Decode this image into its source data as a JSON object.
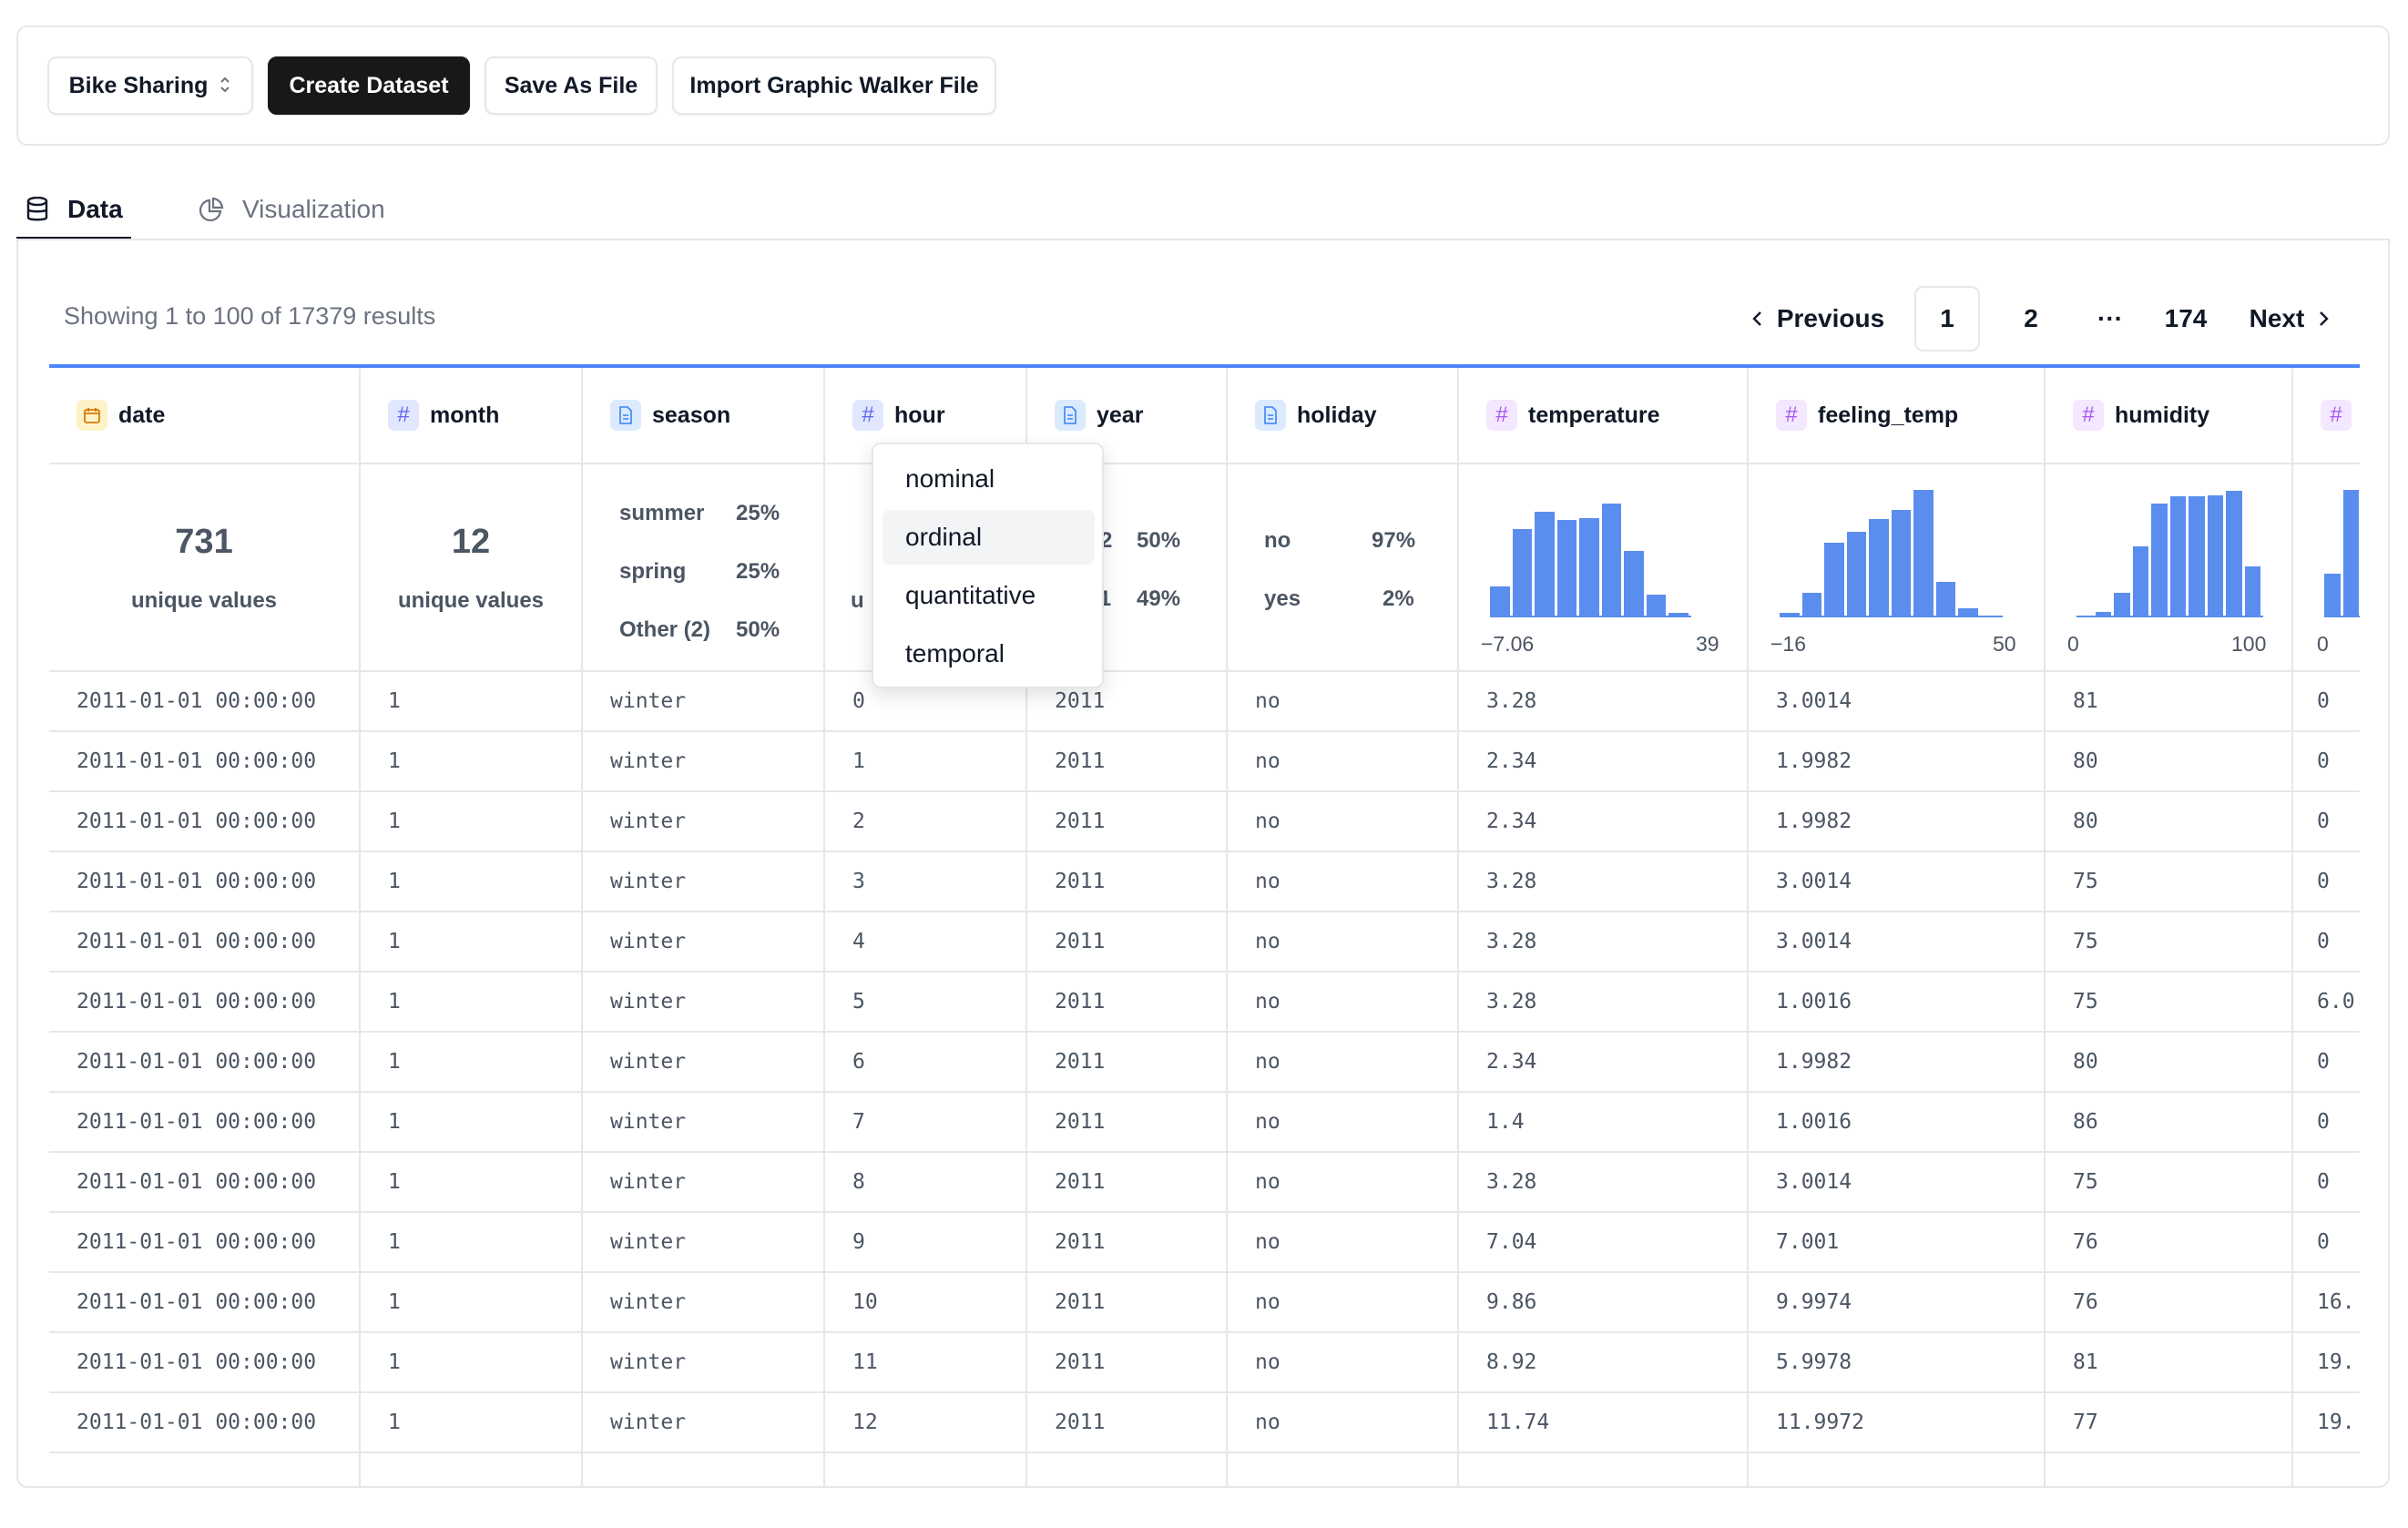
{
  "toolbar": {
    "dataset_select": "Bike Sharing",
    "create_label": "Create Dataset",
    "save_label": "Save As File",
    "import_label": "Import Graphic Walker File"
  },
  "tabs": [
    {
      "label": "Data",
      "icon": "database-icon",
      "active": true
    },
    {
      "label": "Visualization",
      "icon": "pie-chart-icon",
      "active": false
    }
  ],
  "results": {
    "summary": "Showing 1 to 100 of 17379 results"
  },
  "pagination": {
    "previous": "Previous",
    "pages": [
      "1",
      "2",
      "174"
    ],
    "ellipsis": "···",
    "current": "1",
    "next": "Next"
  },
  "columns": [
    {
      "name": "date",
      "type_icon": "calendar-icon"
    },
    {
      "name": "month",
      "type_icon": "hash-icon"
    },
    {
      "name": "season",
      "type_icon": "text-file-icon"
    },
    {
      "name": "hour",
      "type_icon": "hash-icon"
    },
    {
      "name": "year",
      "type_icon": "text-file-icon"
    },
    {
      "name": "holiday",
      "type_icon": "text-file-icon"
    },
    {
      "name": "temperature",
      "type_icon": "hash-icon"
    },
    {
      "name": "feeling_temp",
      "type_icon": "hash-icon"
    },
    {
      "name": "humidity",
      "type_icon": "hash-icon"
    },
    {
      "name": "",
      "type_icon": "hash-icon"
    }
  ],
  "stats": {
    "date": {
      "count": "731",
      "label": "unique values"
    },
    "month": {
      "count": "12",
      "label": "unique values"
    },
    "season": [
      {
        "label": "summer",
        "pct": "25%"
      },
      {
        "label": "spring",
        "pct": "25%"
      },
      {
        "label": "Other (2)",
        "pct": "50%"
      }
    ],
    "hour_partial": "u",
    "year": [
      {
        "label": "2012",
        "pct": "50%"
      },
      {
        "label": "2011",
        "pct": "49%"
      }
    ],
    "holiday": [
      {
        "label": "no",
        "pct": "97%"
      },
      {
        "label": "yes",
        "pct": "2%"
      }
    ],
    "temperature": {
      "min": "−7.06",
      "max": "39",
      "bins": [
        0.25,
        0.73,
        0.88,
        0.81,
        0.82,
        0.95,
        0.55,
        0.18,
        0.02
      ]
    },
    "feeling_temp": {
      "min": "−16",
      "max": "50",
      "bins": [
        0.02,
        0.18,
        0.58,
        0.67,
        0.77,
        0.84,
        1.0,
        0.27,
        0.06,
        0.0
      ]
    },
    "humidity": {
      "min": "0",
      "max": "100",
      "bins": [
        0.0,
        0.03,
        0.18,
        0.55,
        0.89,
        0.95,
        0.95,
        0.96,
        0.99,
        0.39
      ]
    },
    "extra": {
      "min": "0",
      "bins": [
        0.33,
        1.0
      ]
    }
  },
  "rows": [
    [
      "2011-01-01 00:00:00",
      "1",
      "winter",
      "0",
      "2011",
      "no",
      "3.28",
      "3.0014",
      "81",
      "0"
    ],
    [
      "2011-01-01 00:00:00",
      "1",
      "winter",
      "1",
      "2011",
      "no",
      "2.34",
      "1.9982",
      "80",
      "0"
    ],
    [
      "2011-01-01 00:00:00",
      "1",
      "winter",
      "2",
      "2011",
      "no",
      "2.34",
      "1.9982",
      "80",
      "0"
    ],
    [
      "2011-01-01 00:00:00",
      "1",
      "winter",
      "3",
      "2011",
      "no",
      "3.28",
      "3.0014",
      "75",
      "0"
    ],
    [
      "2011-01-01 00:00:00",
      "1",
      "winter",
      "4",
      "2011",
      "no",
      "3.28",
      "3.0014",
      "75",
      "0"
    ],
    [
      "2011-01-01 00:00:00",
      "1",
      "winter",
      "5",
      "2011",
      "no",
      "3.28",
      "1.0016",
      "75",
      "6.0"
    ],
    [
      "2011-01-01 00:00:00",
      "1",
      "winter",
      "6",
      "2011",
      "no",
      "2.34",
      "1.9982",
      "80",
      "0"
    ],
    [
      "2011-01-01 00:00:00",
      "1",
      "winter",
      "7",
      "2011",
      "no",
      "1.4",
      "1.0016",
      "86",
      "0"
    ],
    [
      "2011-01-01 00:00:00",
      "1",
      "winter",
      "8",
      "2011",
      "no",
      "3.28",
      "3.0014",
      "75",
      "0"
    ],
    [
      "2011-01-01 00:00:00",
      "1",
      "winter",
      "9",
      "2011",
      "no",
      "7.04",
      "7.001",
      "76",
      "0"
    ],
    [
      "2011-01-01 00:00:00",
      "1",
      "winter",
      "10",
      "2011",
      "no",
      "9.86",
      "9.9974",
      "76",
      "16."
    ],
    [
      "2011-01-01 00:00:00",
      "1",
      "winter",
      "11",
      "2011",
      "no",
      "8.92",
      "5.9978",
      "81",
      "19."
    ],
    [
      "2011-01-01 00:00:00",
      "1",
      "winter",
      "12",
      "2011",
      "no",
      "11.74",
      "11.9972",
      "77",
      "19."
    ]
  ],
  "semantic_dropdown": {
    "options": [
      "nominal",
      "ordinal",
      "quantitative",
      "temporal"
    ],
    "highlighted": "ordinal"
  },
  "colors": {
    "accent": "#4f86f7",
    "histogram": "#5b8def",
    "primary_button": "#18181b"
  }
}
